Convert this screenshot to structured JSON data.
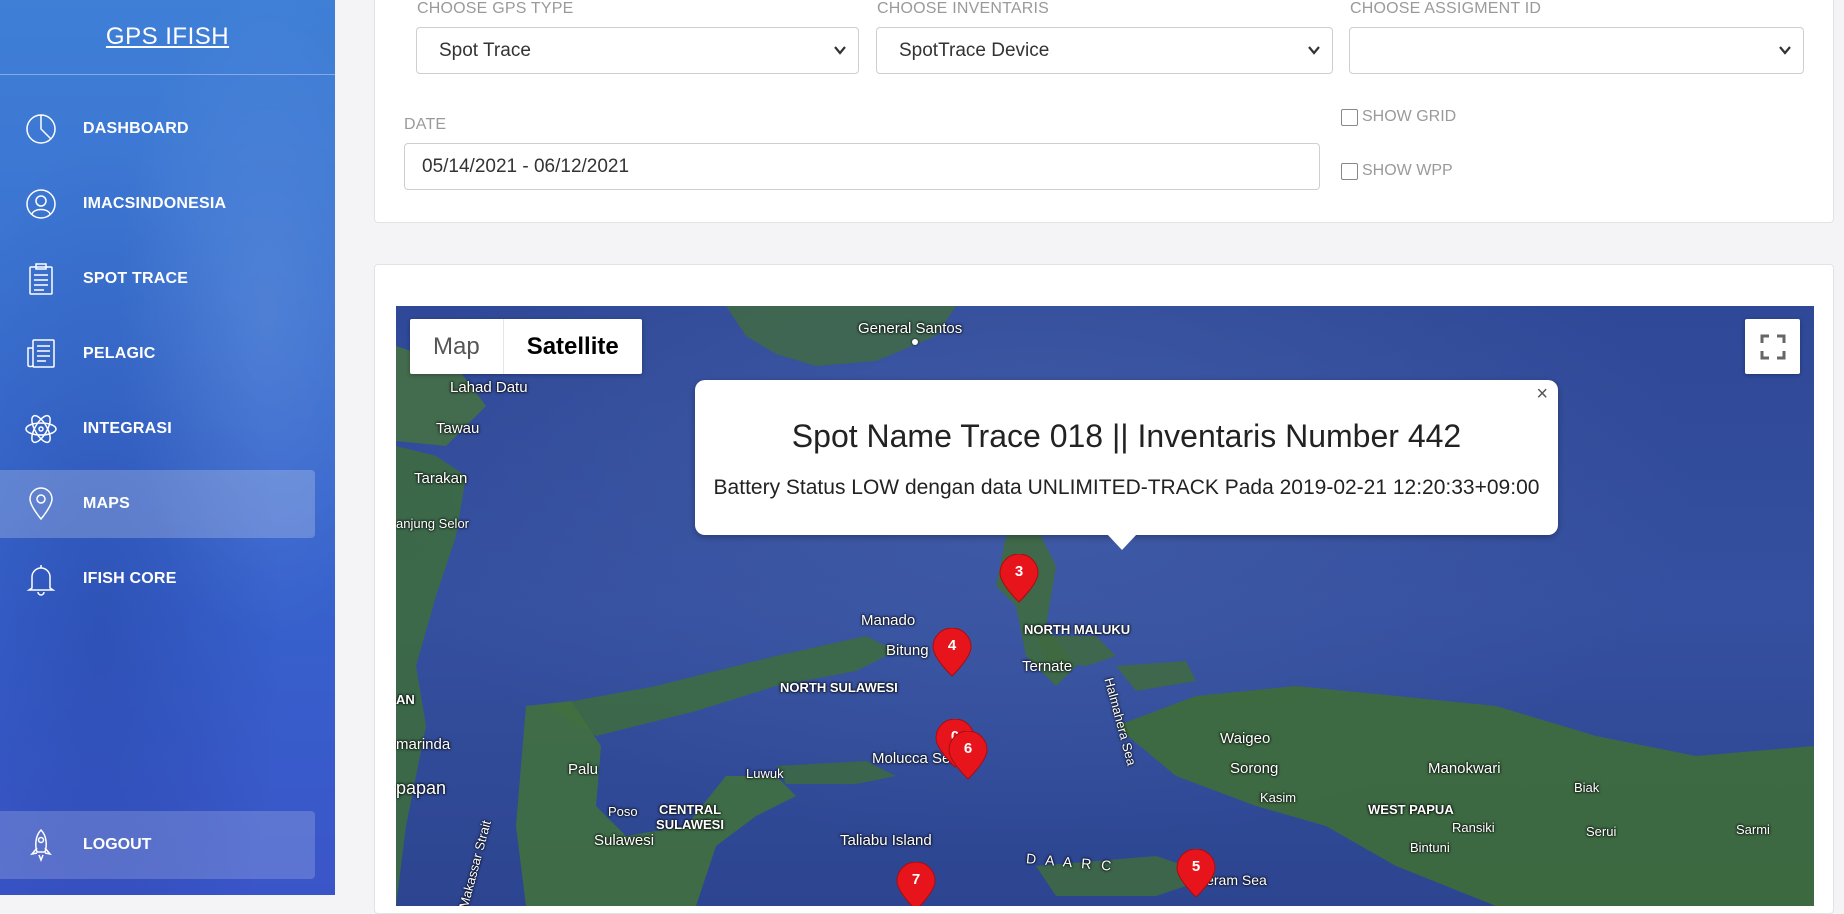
{
  "app": {
    "brand": "GPS IFISH"
  },
  "sidebar": {
    "items": [
      {
        "label": "DASHBOARD",
        "icon": "pie-chart-icon",
        "active": false
      },
      {
        "label": "IMACSINDONESIA",
        "icon": "user-icon",
        "active": false
      },
      {
        "label": "SPOT TRACE",
        "icon": "clipboard-icon",
        "active": false
      },
      {
        "label": "PELAGIC",
        "icon": "newspaper-icon",
        "active": false
      },
      {
        "label": "INTEGRASI",
        "icon": "atom-icon",
        "active": false
      },
      {
        "label": "MAPS",
        "icon": "map-pin-icon",
        "active": true
      },
      {
        "label": "IFISH CORE",
        "icon": "bell-icon",
        "active": false
      }
    ],
    "logout_label": "LOGOUT"
  },
  "filters": {
    "gps_type_label": "CHOOSE GPS TYPE",
    "gps_type_value": "Spot Trace",
    "inventaris_label": "CHOOSE INVENTARIS",
    "inventaris_value": "SpotTrace Device",
    "assignment_label": "CHOOSE ASSIGMENT ID",
    "assignment_value": "",
    "date_label": "DATE",
    "date_value": "05/14/2021 - 06/12/2021",
    "show_grid_label": "SHOW GRID",
    "show_grid_checked": false,
    "show_wpp_label": "SHOW WPP",
    "show_wpp_checked": false
  },
  "map": {
    "type_map_label": "Map",
    "type_satellite_label": "Satellite",
    "selected_type": "Satellite",
    "info_window": {
      "title": "Spot Name Trace 018 || Inventaris Number 442",
      "body": "Battery Status LOW dengan data UNLIMITED-TRACK Pada 2019-02-21 12:20:33+09:00",
      "close": "×"
    },
    "markers": [
      "3",
      "4",
      "0",
      "6",
      "7",
      "5"
    ],
    "marker_color": "#e8141b",
    "places": {
      "general_santos": "General Santos",
      "lahad_datu": "Lahad Datu",
      "tawau": "Tawau",
      "tarakan": "Tarakan",
      "tanjung_selor": "anjung Selor",
      "manado": "Manado",
      "bitung": "Bitung",
      "north_maluku": "NORTH MALUKU",
      "ternate": "Ternate",
      "north_sulawesi": "NORTH SULAWESI",
      "halmahera_sea": "Halmahera Sea",
      "an": "AN",
      "samarinda": "marinda",
      "palu": "Palu",
      "luwuk": "Luwuk",
      "molucca_sea": "Molucca Sea",
      "waigeo": "Waigeo",
      "sorong": "Sorong",
      "manokwari": "Manokwari",
      "kasim": "Kasim",
      "west_papua": "WEST PAPUA",
      "biak": "Biak",
      "poso": "Poso",
      "central_sulawesi": "CENTRAL SULAWESI",
      "balikpapan": "papan",
      "makassar_strait": "Makassar Strait",
      "sulawesi": "Sulawesi",
      "taliabu": "Taliabu Island",
      "banda_arc": "D A   A R C",
      "ceram_sea": "Ceram Sea",
      "ransiki": "Ransiki",
      "bintuni": "Bintuni",
      "serui": "Serui",
      "sarmi": "Sarmi"
    }
  }
}
